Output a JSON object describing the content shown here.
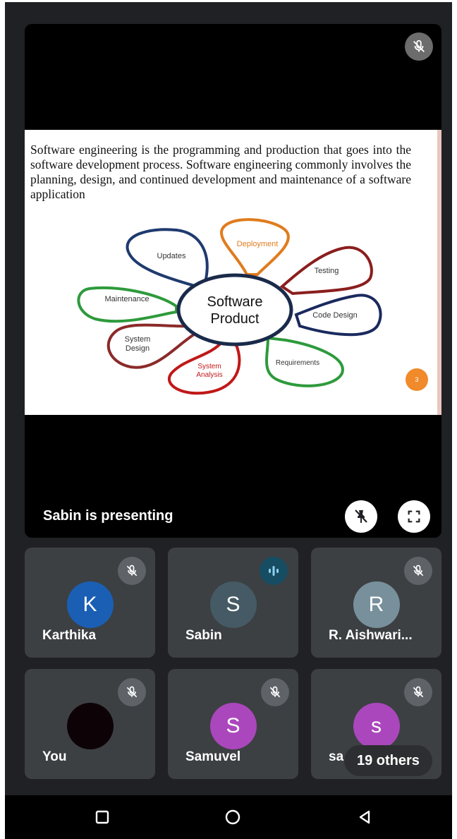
{
  "presentation": {
    "presenter_label": "Sabin is presenting",
    "slide": {
      "paragraph": "Software engineering is the programming and production that goes into the software development process. Software engineering commonly involves the planning, design, and continued development and maintenance of a software application",
      "center_line1": "Software",
      "center_line2": "Product",
      "petals": {
        "updates": "Updates",
        "deployment": "Deployment",
        "testing": "Testing",
        "code_design": "Code Design",
        "requirements": "Requirements",
        "system_analysis_1": "System",
        "system_analysis_2": "Analysis",
        "system_design_1": "System",
        "system_design_2": "Design",
        "maintenance": "Maintenance"
      },
      "page_number": "3"
    },
    "icons": {
      "top_mute": "mic-off-icon",
      "pin": "unpin-icon",
      "fullscreen": "fullscreen-icon"
    }
  },
  "participants": [
    {
      "name": "Karthika",
      "initial": "K",
      "color": "#1a5fb4",
      "status": "muted"
    },
    {
      "name": "Sabin",
      "initial": "S",
      "color": "#455a64",
      "status": "speaking"
    },
    {
      "name": "R. Aishwari...",
      "initial": "R",
      "color": "#78909c",
      "status": "muted"
    },
    {
      "name": "You",
      "initial": "",
      "color": "#0d0306",
      "status": "muted"
    },
    {
      "name": "Samuvel",
      "initial": "S",
      "color": "#ab47bc",
      "status": "muted"
    },
    {
      "name": "sa",
      "initial": "s",
      "color": "#ab47bc",
      "status": "muted",
      "overlay": "19 others"
    }
  ],
  "navbar": {
    "icons": [
      "recents-square-icon",
      "home-circle-icon",
      "back-triangle-icon"
    ]
  }
}
